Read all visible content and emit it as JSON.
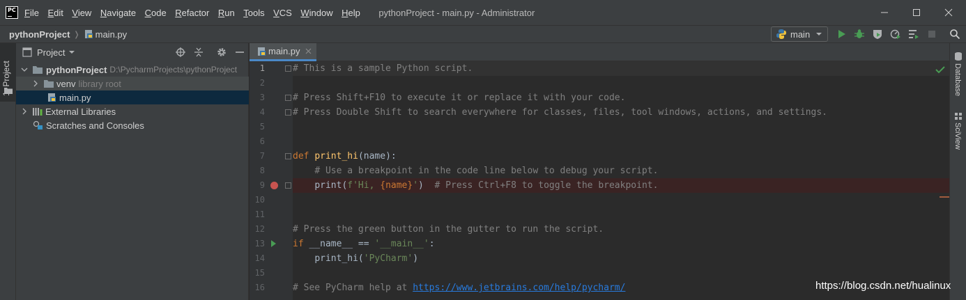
{
  "app": {
    "logo_text": "PC",
    "window_title": "pythonProject - main.py - Administrator"
  },
  "menu": [
    {
      "label": "File",
      "mnemonic": "F",
      "rest": "ile"
    },
    {
      "label": "Edit",
      "mnemonic": "E",
      "rest": "dit"
    },
    {
      "label": "View",
      "mnemonic": "V",
      "rest": "iew"
    },
    {
      "label": "Navigate",
      "mnemonic": "N",
      "rest": "avigate"
    },
    {
      "label": "Code",
      "mnemonic": "C",
      "rest": "ode"
    },
    {
      "label": "Refactor",
      "mnemonic": "R",
      "rest": "efactor"
    },
    {
      "label": "Run",
      "mnemonic": "R",
      "rest": "un"
    },
    {
      "label": "Tools",
      "mnemonic": "T",
      "rest": "ools"
    },
    {
      "label": "VCS",
      "mnemonic": "V",
      "rest": "CS"
    },
    {
      "label": "Window",
      "mnemonic": "W",
      "rest": "indow"
    },
    {
      "label": "Help",
      "mnemonic": "H",
      "rest": "elp"
    }
  ],
  "navbar": {
    "project": "pythonProject",
    "file": "main.py",
    "run_config": "main"
  },
  "left_strip": {
    "project_tab": "1: Project"
  },
  "project_panel": {
    "header": "Project",
    "tree": {
      "root": {
        "name": "pythonProject",
        "path": "D:\\PycharmProjects\\pythonProject"
      },
      "venv": {
        "name": "venv",
        "hint": "library root"
      },
      "main": {
        "name": "main.py"
      },
      "external": {
        "name": "External Libraries"
      },
      "scratches": {
        "name": "Scratches and Consoles"
      }
    }
  },
  "editor": {
    "tab_label": "main.py",
    "line_numbers": [
      "1",
      "2",
      "3",
      "4",
      "5",
      "6",
      "7",
      "8",
      "9",
      "10",
      "11",
      "12",
      "13",
      "14",
      "15",
      "16"
    ],
    "code": {
      "l1": "# This is a sample Python script.",
      "l3": "# Press Shift+F10 to execute it or replace it with your code.",
      "l4": "# Press Double Shift to search everywhere for classes, files, tool windows, actions, and settings.",
      "l7_kw": "def",
      "l7_fn": "print_hi",
      "l7_rest": "(name):",
      "l8": "# Use a breakpoint in the code line below to debug your script.",
      "l9_a": "print(",
      "l9_str1": "f'Hi, ",
      "l9_var": "{name}",
      "l9_str2": "'",
      "l9_b": ")  ",
      "l9_cmt": "# Press Ctrl+F8 to toggle the breakpoint.",
      "l12": "# Press the green button in the gutter to run the script.",
      "l13_kw": "if",
      "l13_a": " __name__ == ",
      "l13_str": "'__main__'",
      "l13_b": ":",
      "l14_a": "print_hi(",
      "l14_str": "'PyCharm'",
      "l14_b": ")",
      "l16_cmt": "# See PyCharm help at ",
      "l16_link": "https://www.jetbrains.com/help/pycharm/"
    }
  },
  "right_strip": {
    "database": "Database",
    "sciview": "SciView"
  },
  "watermark": "https://blog.csdn.net/hualinux",
  "colors": {
    "accent": "#4a88c7",
    "run_green": "#499c54",
    "breakpoint_red": "#c75450"
  }
}
